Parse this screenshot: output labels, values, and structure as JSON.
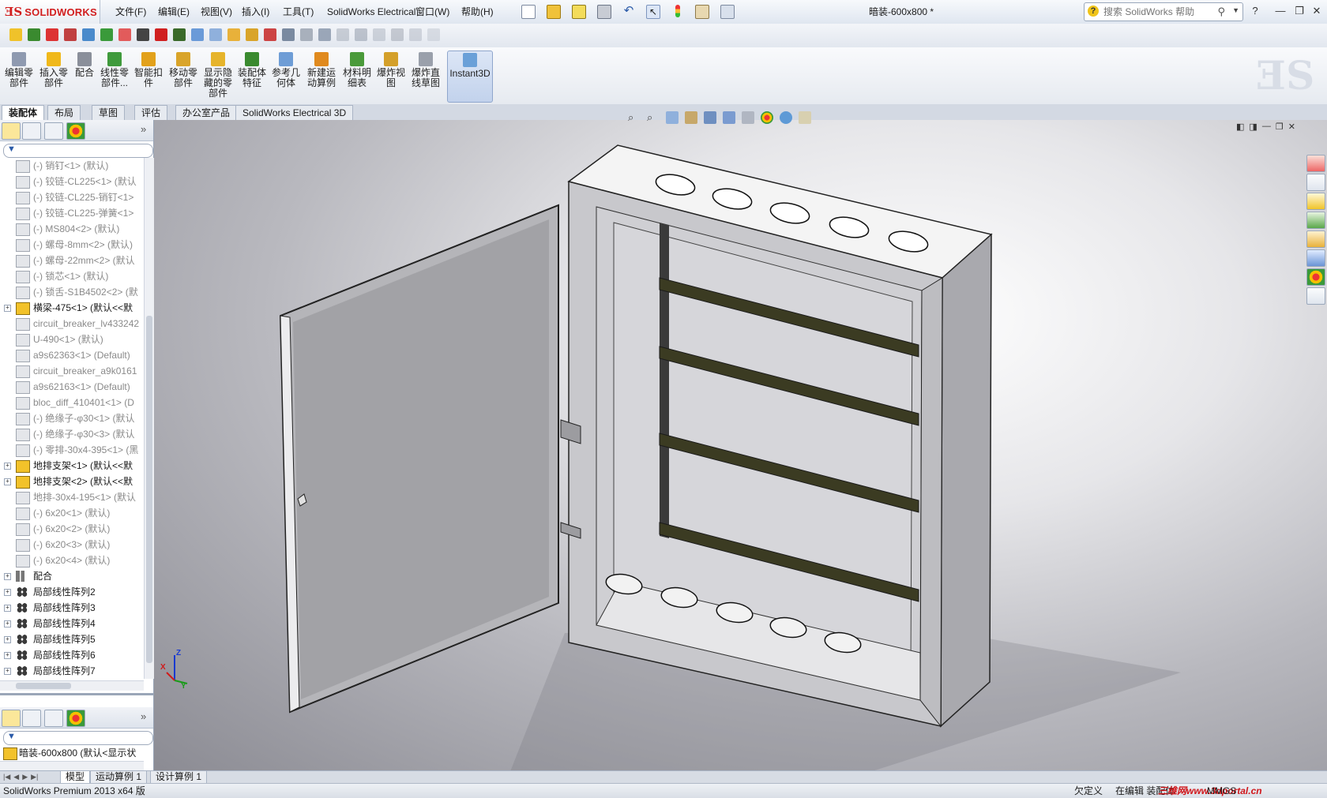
{
  "app": {
    "logo_text": "SOLIDWORKS",
    "document_title": "暗装-600x800 *"
  },
  "menu": [
    "文件(F)",
    "编辑(E)",
    "视图(V)",
    "插入(I)",
    "工具(T)",
    "SolidWorks Electrical",
    "窗口(W)",
    "帮助(H)"
  ],
  "help_search": {
    "placeholder": "搜索 SolidWorks 帮助"
  },
  "command_manager": [
    {
      "label": "编辑零部件",
      "color": "#8f9ab0"
    },
    {
      "label": "插入零部件",
      "color": "#f0b81a"
    },
    {
      "label": "配合",
      "color": "#8a8f9a"
    },
    {
      "label": "线性零部件...",
      "color": "#3f9a3c"
    },
    {
      "label": "智能扣件",
      "color": "#e2a11b"
    },
    {
      "label": "移动零部件",
      "color": "#d9a42a"
    },
    {
      "label": "显示隐藏的零部件",
      "color": "#e6b42b"
    },
    {
      "label": "装配体特征",
      "color": "#3a8a2f"
    },
    {
      "label": "参考几何体",
      "color": "#6e9dd6"
    },
    {
      "label": "新建运动算例",
      "color": "#e08a1e"
    },
    {
      "label": "材料明细表",
      "color": "#4a9a3a"
    },
    {
      "label": "爆炸视图",
      "color": "#d4a02a"
    },
    {
      "label": "爆炸直线草图",
      "color": "#9aa0ab"
    },
    {
      "label": "Instant3D",
      "color": "#6aa0d8"
    }
  ],
  "tabs": [
    "装配体",
    "布局",
    "草图",
    "评估",
    "办公室产品",
    "SolidWorks Electrical 3D"
  ],
  "tree": [
    {
      "label": "(-) 销钉<1> (默认)",
      "suppressed": true,
      "expander": false,
      "kind": "part"
    },
    {
      "label": "(-) 铰链-CL225<1> (默认",
      "suppressed": true,
      "expander": false,
      "kind": "part"
    },
    {
      "label": "(-) 铰链-CL225-销钉<1>",
      "suppressed": true,
      "expander": false,
      "kind": "part"
    },
    {
      "label": "(-) 铰链-CL225-弹簧<1>",
      "suppressed": true,
      "expander": false,
      "kind": "part"
    },
    {
      "label": "(-) MS804<2> (默认)",
      "suppressed": true,
      "expander": false,
      "kind": "part"
    },
    {
      "label": "(-) 螺母-8mm<2> (默认)",
      "suppressed": true,
      "expander": false,
      "kind": "part"
    },
    {
      "label": "(-) 螺母-22mm<2> (默认",
      "suppressed": true,
      "expander": false,
      "kind": "part"
    },
    {
      "label": "(-) 锁芯<1> (默认)",
      "suppressed": true,
      "expander": false,
      "kind": "part"
    },
    {
      "label": "(-) 锁舌-S1B4502<2> (默",
      "suppressed": true,
      "expander": false,
      "kind": "part"
    },
    {
      "label": "横梁-475<1> (默认<<默",
      "suppressed": false,
      "expander": true,
      "kind": "asm"
    },
    {
      "label": "circuit_breaker_lv433242",
      "suppressed": true,
      "expander": false,
      "kind": "part"
    },
    {
      "label": "U-490<1> (默认)",
      "suppressed": true,
      "expander": false,
      "kind": "part"
    },
    {
      "label": "a9s62363<1> (Default)",
      "suppressed": true,
      "expander": false,
      "kind": "part"
    },
    {
      "label": "circuit_breaker_a9k0161",
      "suppressed": true,
      "expander": false,
      "kind": "part"
    },
    {
      "label": "a9s62163<1> (Default)",
      "suppressed": true,
      "expander": false,
      "kind": "part"
    },
    {
      "label": "bloc_diff_410401<1> (D",
      "suppressed": true,
      "expander": false,
      "kind": "part"
    },
    {
      "label": "(-) 绝缘子-φ30<1> (默认",
      "suppressed": true,
      "expander": false,
      "kind": "part"
    },
    {
      "label": "(-) 绝缘子-φ30<3> (默认",
      "suppressed": true,
      "expander": false,
      "kind": "part"
    },
    {
      "label": "(-) 零排-30x4-395<1> (黑",
      "suppressed": true,
      "expander": false,
      "kind": "part"
    },
    {
      "label": "地排支架<1> (默认<<默",
      "suppressed": false,
      "expander": true,
      "kind": "asm"
    },
    {
      "label": "地排支架<2> (默认<<默",
      "suppressed": false,
      "expander": true,
      "kind": "asm"
    },
    {
      "label": "地排-30x4-195<1> (默认",
      "suppressed": true,
      "expander": false,
      "kind": "part"
    },
    {
      "label": "(-) 6x20<1> (默认)",
      "suppressed": true,
      "expander": false,
      "kind": "part"
    },
    {
      "label": "(-) 6x20<2> (默认)",
      "suppressed": true,
      "expander": false,
      "kind": "part"
    },
    {
      "label": "(-) 6x20<3> (默认)",
      "suppressed": true,
      "expander": false,
      "kind": "part"
    },
    {
      "label": "(-) 6x20<4> (默认)",
      "suppressed": true,
      "expander": false,
      "kind": "part"
    },
    {
      "label": "配合",
      "suppressed": false,
      "expander": true,
      "kind": "mate"
    },
    {
      "label": "局部线性阵列2",
      "suppressed": false,
      "expander": true,
      "kind": "pattern"
    },
    {
      "label": "局部线性阵列3",
      "suppressed": false,
      "expander": true,
      "kind": "pattern"
    },
    {
      "label": "局部线性阵列4",
      "suppressed": false,
      "expander": true,
      "kind": "pattern"
    },
    {
      "label": "局部线性阵列5",
      "suppressed": false,
      "expander": true,
      "kind": "pattern"
    },
    {
      "label": "局部线性阵列6",
      "suppressed": false,
      "expander": true,
      "kind": "pattern"
    },
    {
      "label": "局部线性阵列7",
      "suppressed": false,
      "expander": true,
      "kind": "pattern"
    }
  ],
  "config_panel": {
    "item_label": "暗装-600x800 (默认<显示状"
  },
  "bottom_tabs": [
    "模型",
    "运动算例 1",
    "设计算例 1"
  ],
  "status": {
    "app_version": "SolidWorks Premium 2013 x64 版",
    "definition": "欠定义",
    "editing": "在编辑 装配体",
    "units": "MMGS",
    "watermark": "三维网www.3dportal.cn"
  },
  "viewport_axes": {
    "x": "X",
    "y": "Y",
    "z": "Z"
  }
}
